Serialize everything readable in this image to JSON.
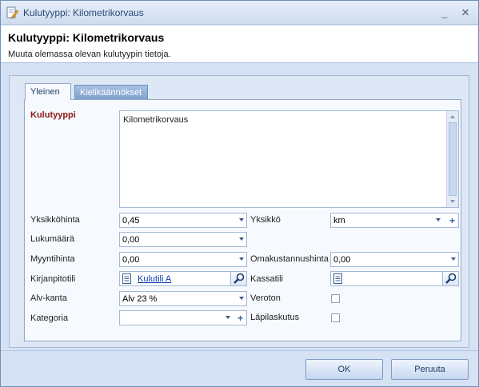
{
  "window": {
    "title": "Kulutyyppi: Kilometrikorvaus"
  },
  "header": {
    "title": "Kulutyyppi: Kilometrikorvaus",
    "subtitle": "Muuta olemassa olevan kulutyypin tietoja."
  },
  "tabs": [
    {
      "label": "Yleinen",
      "active": true
    },
    {
      "label": "Kielikäännökset",
      "active": false
    }
  ],
  "form": {
    "kulutyyppi": {
      "label": "Kulutyyppi",
      "value": "Kilometrikorvaus"
    },
    "yksikkohinta": {
      "label": "Yksikköhinta",
      "value": "0,45"
    },
    "yksikko": {
      "label": "Yksikkö",
      "value": "km"
    },
    "lukumaara": {
      "label": "Lukumäärä",
      "value": "0,00"
    },
    "myyntihinta": {
      "label": "Myyntihinta",
      "value": "0,00"
    },
    "omakustannushinta": {
      "label": "Omakustannushinta",
      "value": "0,00"
    },
    "kirjanpitotili": {
      "label": "Kirjanpitotili",
      "value": "Kulutili A"
    },
    "kassatili": {
      "label": "Kassatili",
      "value": ""
    },
    "alvkanta": {
      "label": "Alv-kanta",
      "value": "Alv 23 %"
    },
    "veroton": {
      "label": "Veroton",
      "checked": false
    },
    "kategoria": {
      "label": "Kategoria",
      "value": ""
    },
    "lapilaskutus": {
      "label": "Läpilaskutus",
      "checked": false
    }
  },
  "buttons": {
    "ok": "OK",
    "cancel": "Peruuta"
  },
  "colors": {
    "required_label": "#8b1a1a",
    "link": "#0b3bb0",
    "frame": "#d5e2f3"
  }
}
